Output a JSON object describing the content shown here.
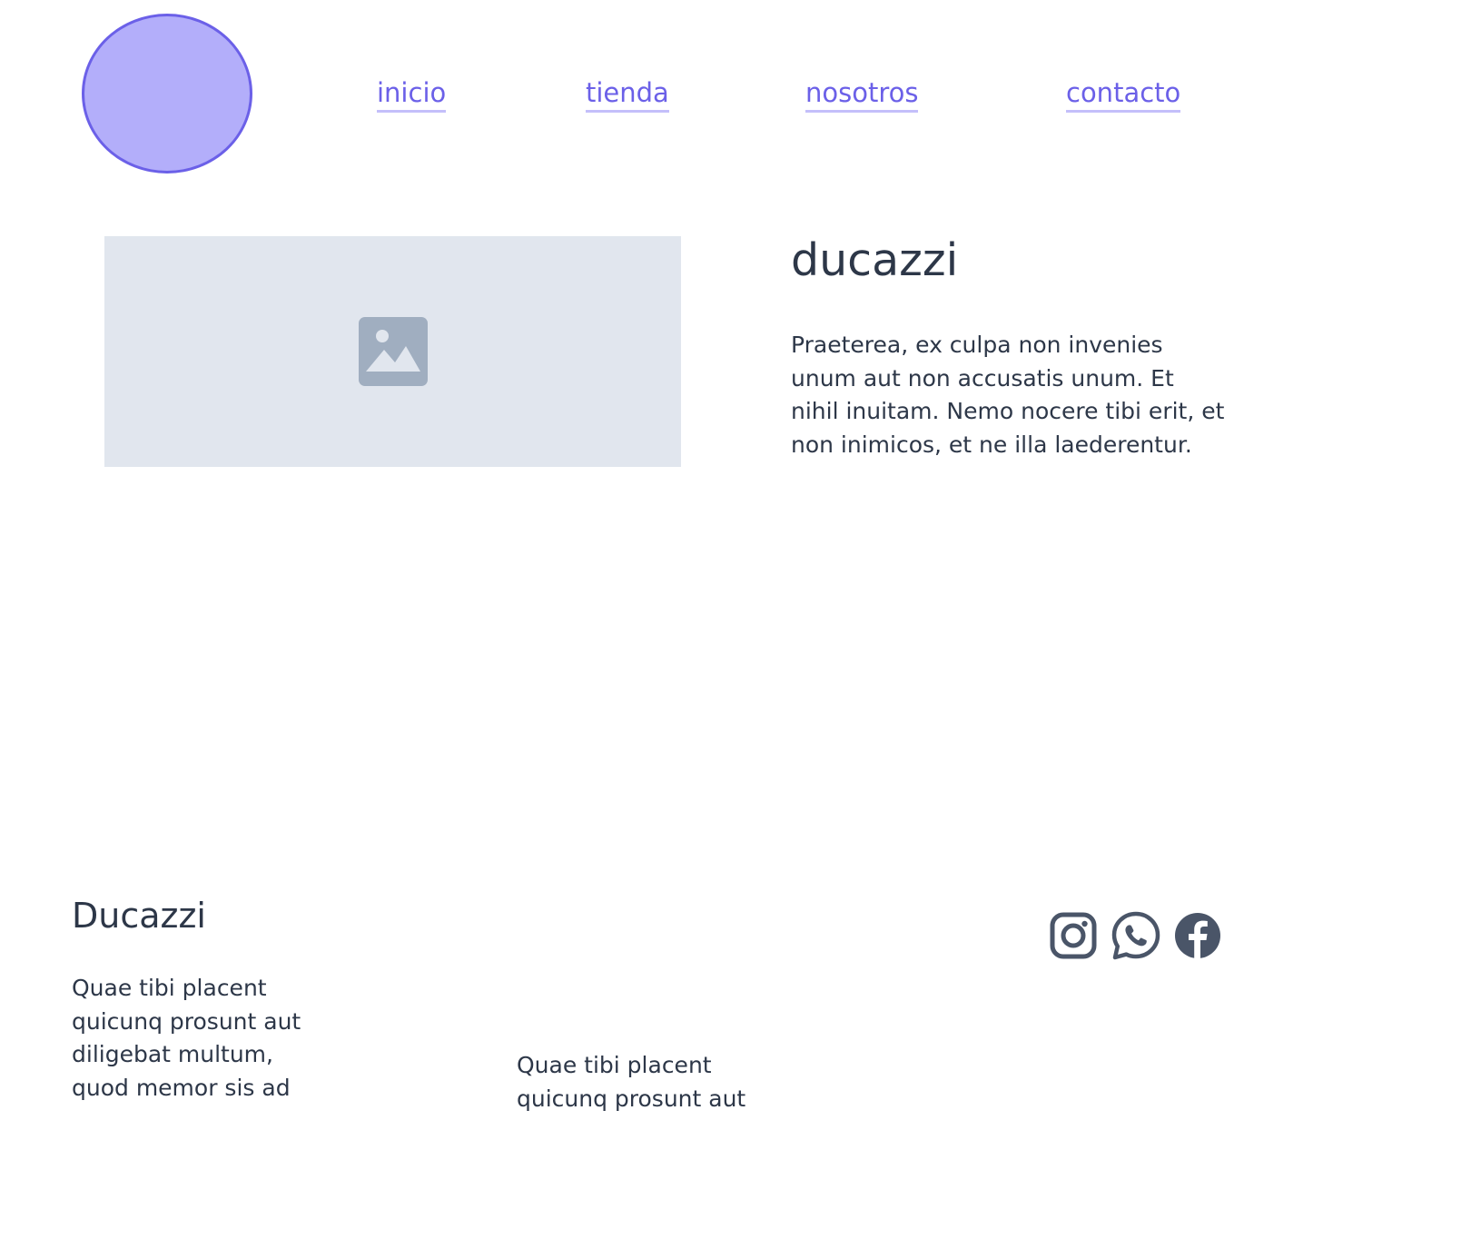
{
  "header": {
    "logo_icon": "circle-logo",
    "nav": [
      {
        "label": "inicio"
      },
      {
        "label": "tienda"
      },
      {
        "label": "nosotros"
      },
      {
        "label": "contacto"
      }
    ]
  },
  "hero": {
    "image_icon": "image-placeholder-icon",
    "title": "ducazzi",
    "text": "Praeterea, ex culpa non invenies unum aut non accusatis unum. Et nihil inuitam. Nemo nocere tibi erit, et non inimicos, et ne illa laederentur."
  },
  "footer": {
    "brand": "Ducazzi",
    "text_1": "Quae tibi placent quicunq prosunt aut diligebat multum, quod memor sis ad",
    "text_2": "Quae tibi placent quicunq prosunt aut",
    "social": [
      {
        "icon": "instagram-icon"
      },
      {
        "icon": "whatsapp-icon"
      },
      {
        "icon": "facebook-icon"
      }
    ]
  },
  "colors": {
    "accent": "#6b60e8",
    "logo_fill": "#b3aefa",
    "text": "#2d3748",
    "placeholder_bg": "#e1e6ee",
    "placeholder_icon": "#a0aec0",
    "social_icon": "#4a5568"
  }
}
